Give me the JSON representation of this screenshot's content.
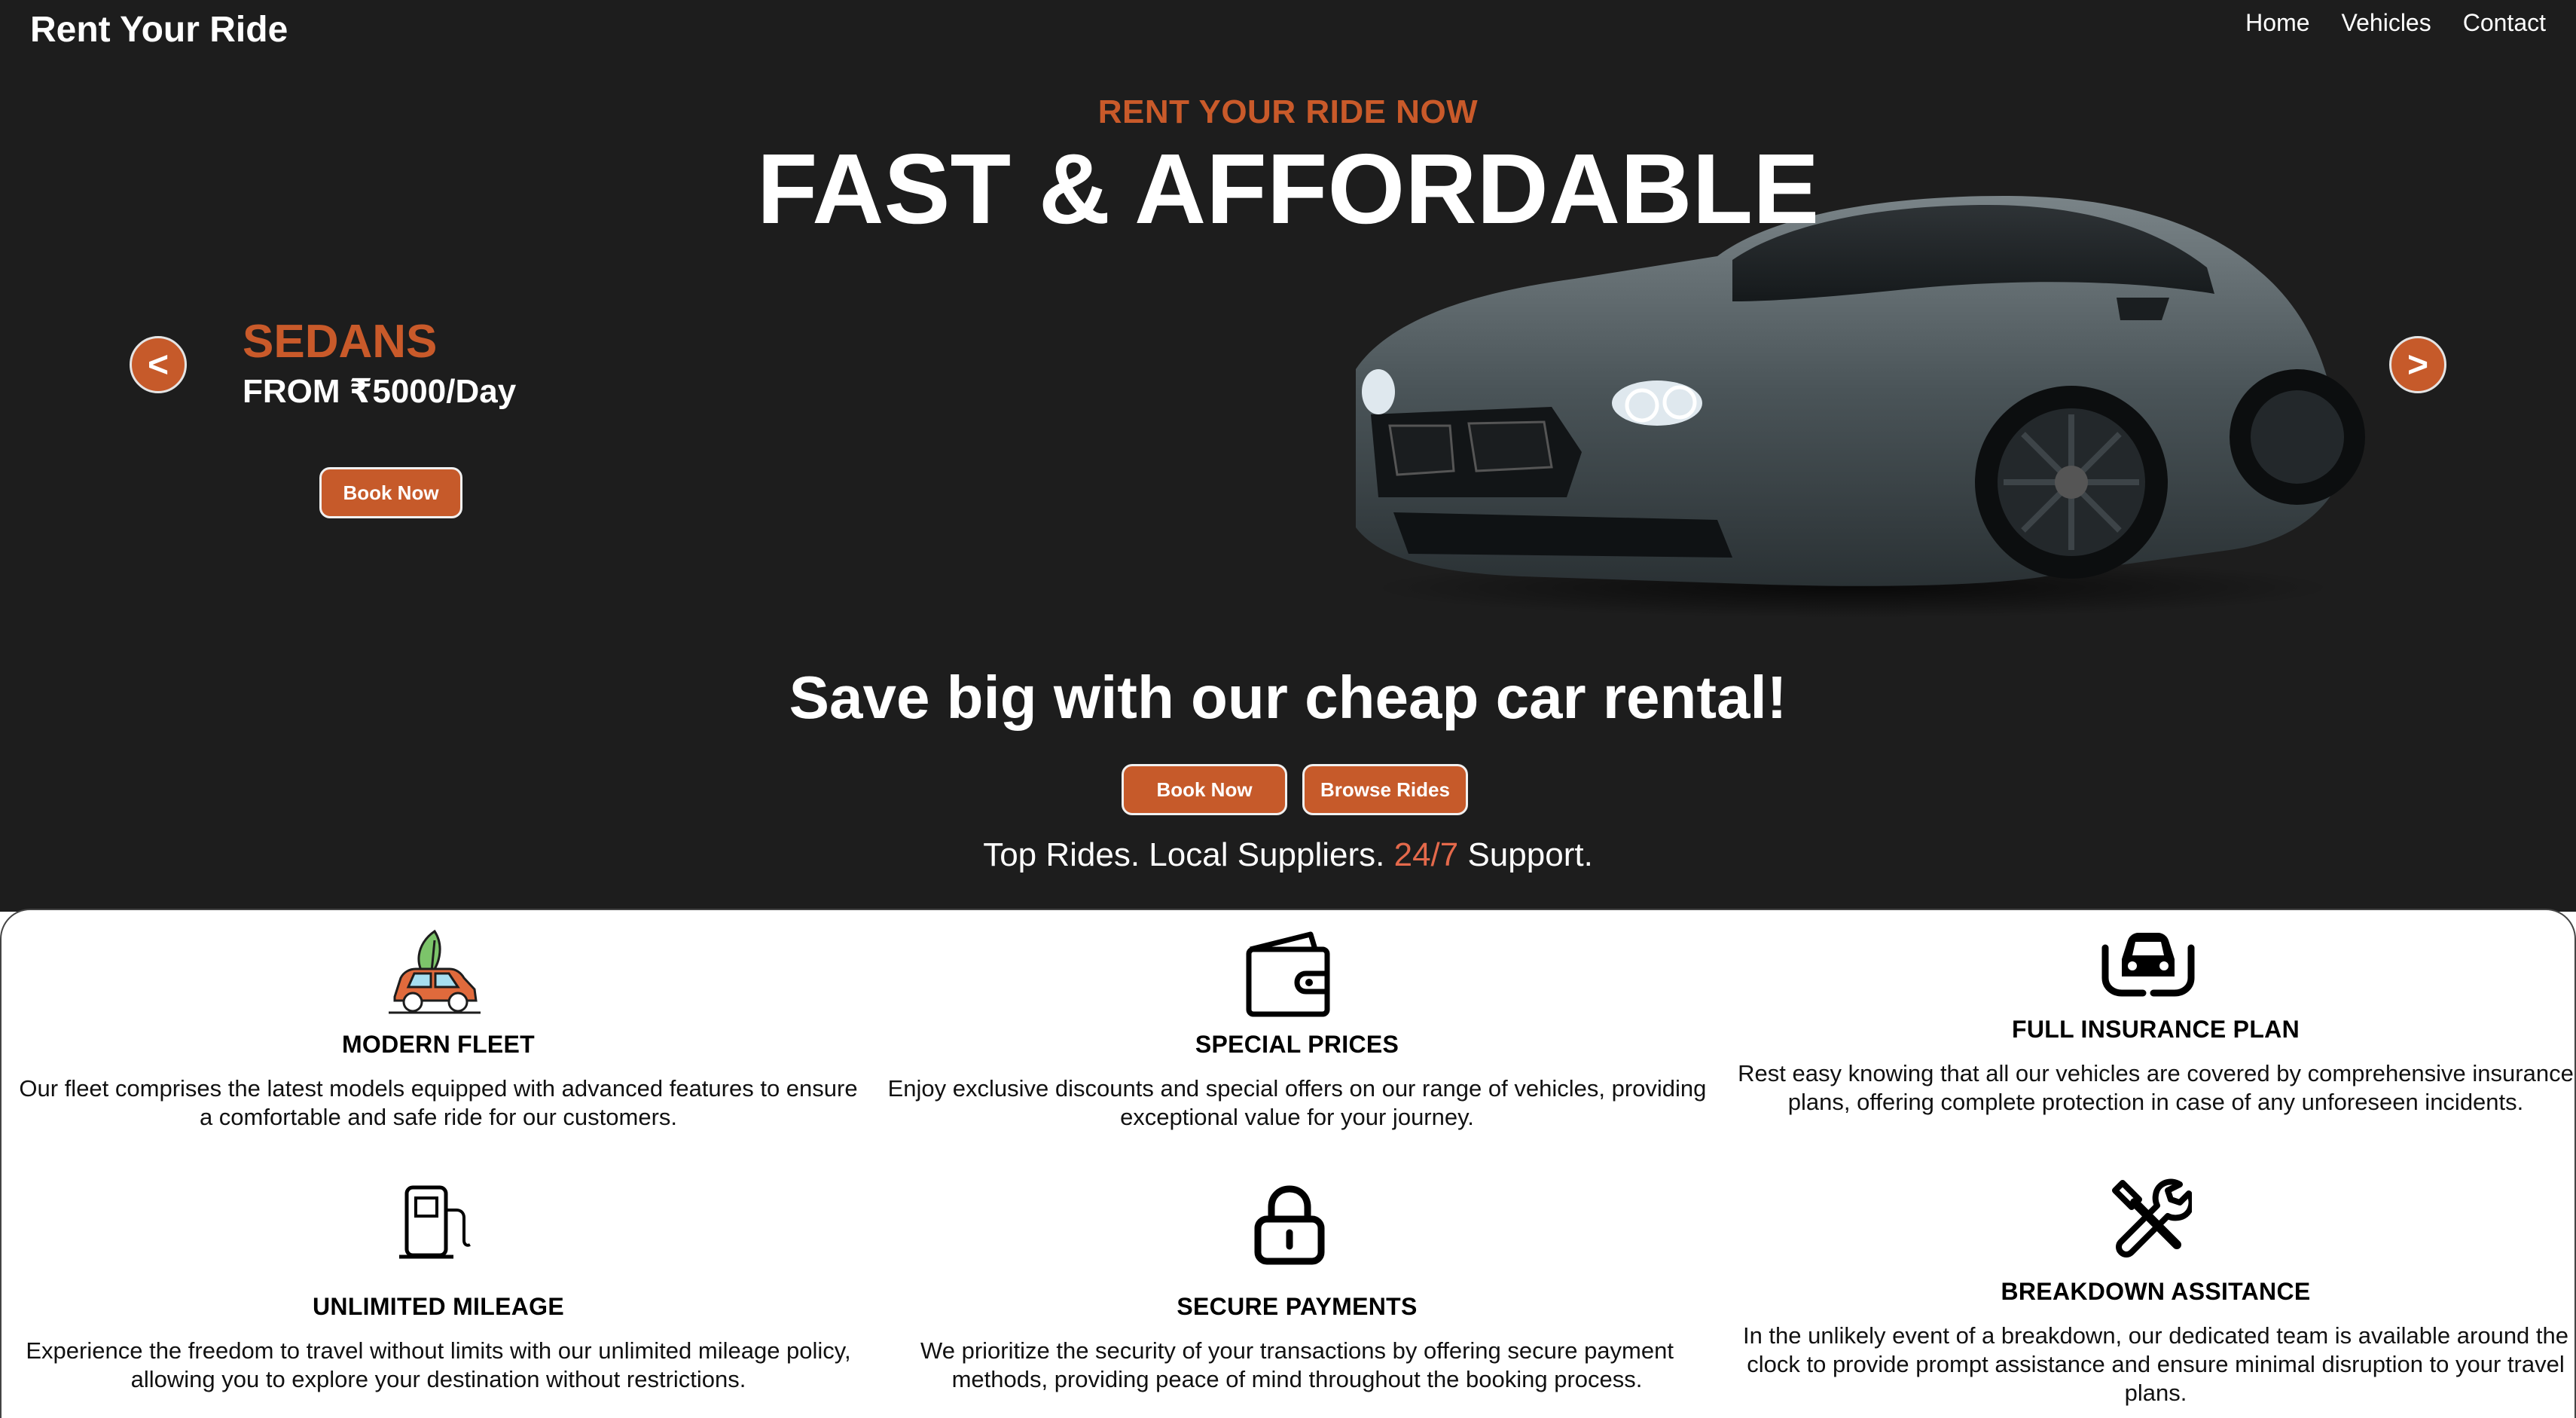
{
  "header": {
    "brand": "Rent Your Ride",
    "nav": [
      "Home",
      "Vehicles",
      "Contact"
    ]
  },
  "hero": {
    "kicker": "RENT YOUR RIDE NOW",
    "headline": "FAST & AFFORDABLE",
    "prev_label": "<",
    "next_label": ">",
    "slide": {
      "category": "SEDANS",
      "price": "FROM ₹5000/Day",
      "book_label": "Book Now"
    },
    "tagline": "Save big with our cheap car rental!",
    "book_label": "Book Now",
    "browse_label": "Browse Rides",
    "support_pre": "Top Rides. Local Suppliers. ",
    "support_accent": "24/7",
    "support_post": " Support."
  },
  "features": [
    {
      "title": "MODERN FLEET",
      "icon": "eco-car-icon",
      "text": "Our fleet comprises the latest models equipped with advanced features to ensure a comfortable and safe ride for our customers."
    },
    {
      "title": "SPECIAL PRICES",
      "icon": "wallet-icon",
      "text": "Enjoy exclusive discounts and special offers on our range of vehicles, providing exceptional value for your journey."
    },
    {
      "title": "FULL INSURANCE PLAN",
      "icon": "car-insurance-icon",
      "text": "Rest easy knowing that all our vehicles are covered by comprehensive insurance plans, offering complete protection in case of any unforeseen incidents."
    },
    {
      "title": "UNLIMITED MILEAGE",
      "icon": "fuel-pump-icon",
      "text": "Experience the freedom to travel without limits with our unlimited mileage policy, allowing you to explore your destination without restrictions."
    },
    {
      "title": "SECURE PAYMENTS",
      "icon": "lock-icon",
      "text": "We prioritize the security of your transactions by offering secure payment methods, providing peace of mind throughout the booking process."
    },
    {
      "title": "BREAKDOWN ASSITANCE",
      "icon": "tools-icon",
      "text": "In the unlikely event of a breakdown, our dedicated team is available around the clock to provide prompt assistance and ensure minimal disruption to your travel plans."
    }
  ],
  "colors": {
    "hero_bg": "#1d1d1d",
    "accent": "#c95a2a",
    "support_accent": "#e4694b",
    "text_light": "#ffffff"
  }
}
